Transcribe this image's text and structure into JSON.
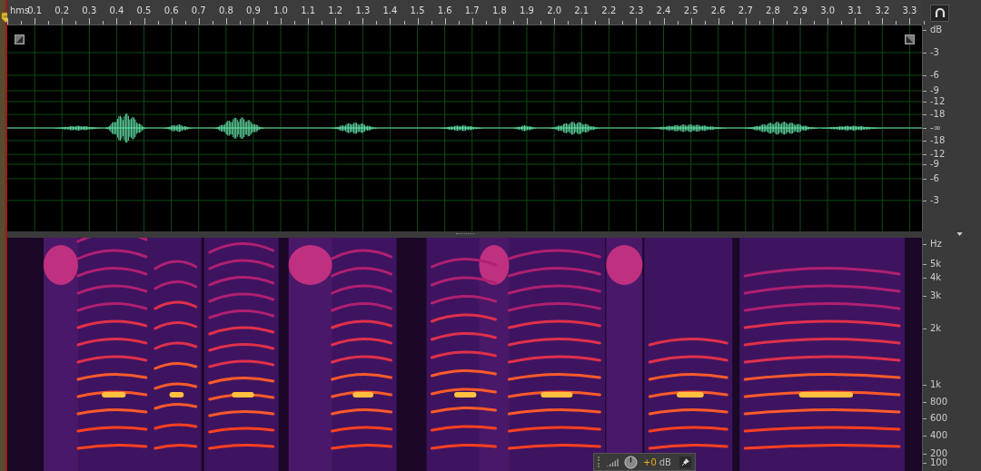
{
  "ruler": {
    "unit": "hms",
    "labels": [
      "0.1",
      "0.2",
      "0.3",
      "0.4",
      "0.5",
      "0.6",
      "0.7",
      "0.8",
      "0.9",
      "1.0",
      "1.1",
      "1.2",
      "1.3",
      "1.4",
      "1.5",
      "1.6",
      "1.7",
      "1.8",
      "1.9",
      "2.0",
      "2.1",
      "2.2",
      "2.3",
      "2.4",
      "2.5",
      "2.6",
      "2.7",
      "2.8",
      "2.9",
      "3.0",
      "3.1",
      "3.2",
      "3.3"
    ]
  },
  "waveform": {
    "db_scale": [
      "dB",
      "-3",
      "-6",
      "-9",
      "-12",
      "-18",
      "-∞",
      "-18",
      "-12",
      "-9",
      "-6",
      "-3"
    ]
  },
  "spectrogram": {
    "hz_scale": [
      "Hz",
      "5k",
      "4k",
      "3k",
      "2k",
      "1k",
      "800",
      "600",
      "400",
      "200",
      "100"
    ]
  },
  "hud": {
    "gain": "+0",
    "unit": "dB"
  }
}
